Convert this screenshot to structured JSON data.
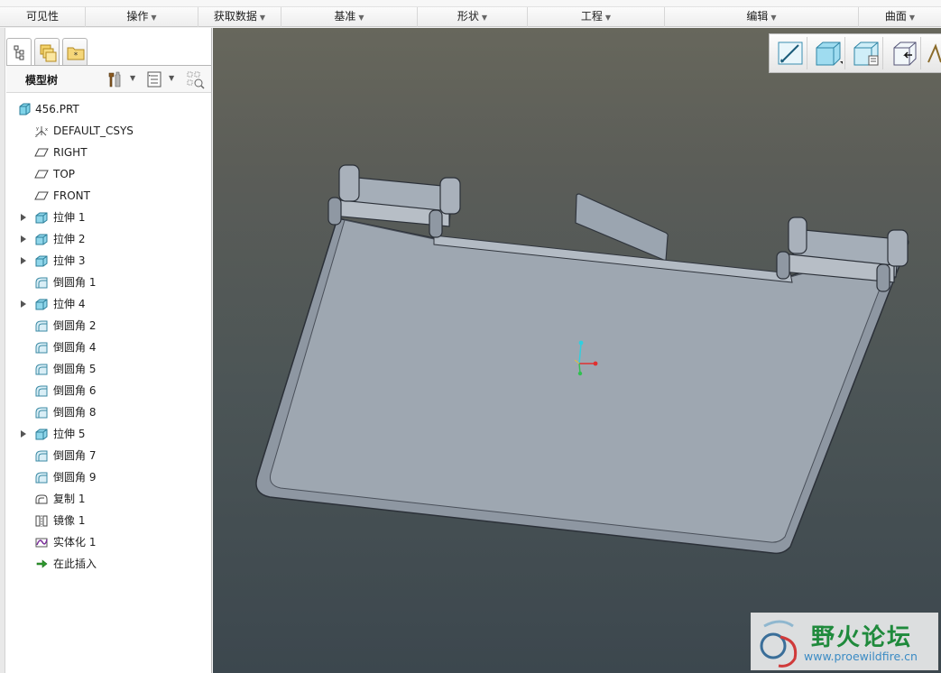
{
  "ribbon": {
    "groups": [
      {
        "label": "可见性",
        "dropdown": false
      },
      {
        "label": "操作",
        "dropdown": true
      },
      {
        "label": "获取数据",
        "dropdown": true
      },
      {
        "label": "基准",
        "dropdown": true
      },
      {
        "label": "形状",
        "dropdown": true
      },
      {
        "label": "工程",
        "dropdown": true
      },
      {
        "label": "编辑",
        "dropdown": true
      },
      {
        "label": "曲面",
        "dropdown": true
      }
    ]
  },
  "panel": {
    "tabs": [
      "model-tree-tab",
      "layers-tab",
      "favorites-tab"
    ],
    "title": "模型树"
  },
  "tree": {
    "root": {
      "label": "456.PRT",
      "icon": "part-icon"
    },
    "items": [
      {
        "label": "DEFAULT_CSYS",
        "icon": "csys-icon",
        "expandable": false
      },
      {
        "label": "RIGHT",
        "icon": "datum-plane-icon",
        "expandable": false
      },
      {
        "label": "TOP",
        "icon": "datum-plane-icon",
        "expandable": false
      },
      {
        "label": "FRONT",
        "icon": "datum-plane-icon",
        "expandable": false
      },
      {
        "label": "拉伸 1",
        "icon": "extrude-icon",
        "expandable": true
      },
      {
        "label": "拉伸 2",
        "icon": "extrude-icon",
        "expandable": true
      },
      {
        "label": "拉伸 3",
        "icon": "extrude-icon",
        "expandable": true
      },
      {
        "label": "倒圆角 1",
        "icon": "round-icon",
        "expandable": false
      },
      {
        "label": "拉伸 4",
        "icon": "extrude-icon",
        "expandable": true
      },
      {
        "label": "倒圆角 2",
        "icon": "round-icon",
        "expandable": false
      },
      {
        "label": "倒圆角 4",
        "icon": "round-icon",
        "expandable": false
      },
      {
        "label": "倒圆角 5",
        "icon": "round-icon",
        "expandable": false
      },
      {
        "label": "倒圆角 6",
        "icon": "round-icon",
        "expandable": false
      },
      {
        "label": "倒圆角 8",
        "icon": "round-icon",
        "expandable": false
      },
      {
        "label": "拉伸 5",
        "icon": "extrude-icon",
        "expandable": true
      },
      {
        "label": "倒圆角 7",
        "icon": "round-icon",
        "expandable": false
      },
      {
        "label": "倒圆角 9",
        "icon": "round-icon",
        "expandable": false
      },
      {
        "label": "复制 1",
        "icon": "copy-icon",
        "expandable": false
      },
      {
        "label": "镜像 1",
        "icon": "mirror-icon",
        "expandable": false
      },
      {
        "label": "实体化 1",
        "icon": "solidify-icon",
        "expandable": false
      },
      {
        "label": "在此插入",
        "icon": "insert-here-icon",
        "expandable": false
      }
    ]
  },
  "view_toolbar": {
    "buttons": [
      "sketch-view-icon",
      "shaded-view-icon",
      "saved-views-icon",
      "named-view-icon"
    ]
  },
  "watermark": {
    "name": "野火论坛",
    "url": "www.proewildfire.cn"
  },
  "colors": {
    "viewport_top": "#67675c",
    "viewport_bottom": "#3c474e",
    "model_face": "#98a1ac",
    "model_edge": "#2d323a",
    "watermark_green": "#1f8a3c",
    "watermark_blue": "#3b8bc4"
  }
}
